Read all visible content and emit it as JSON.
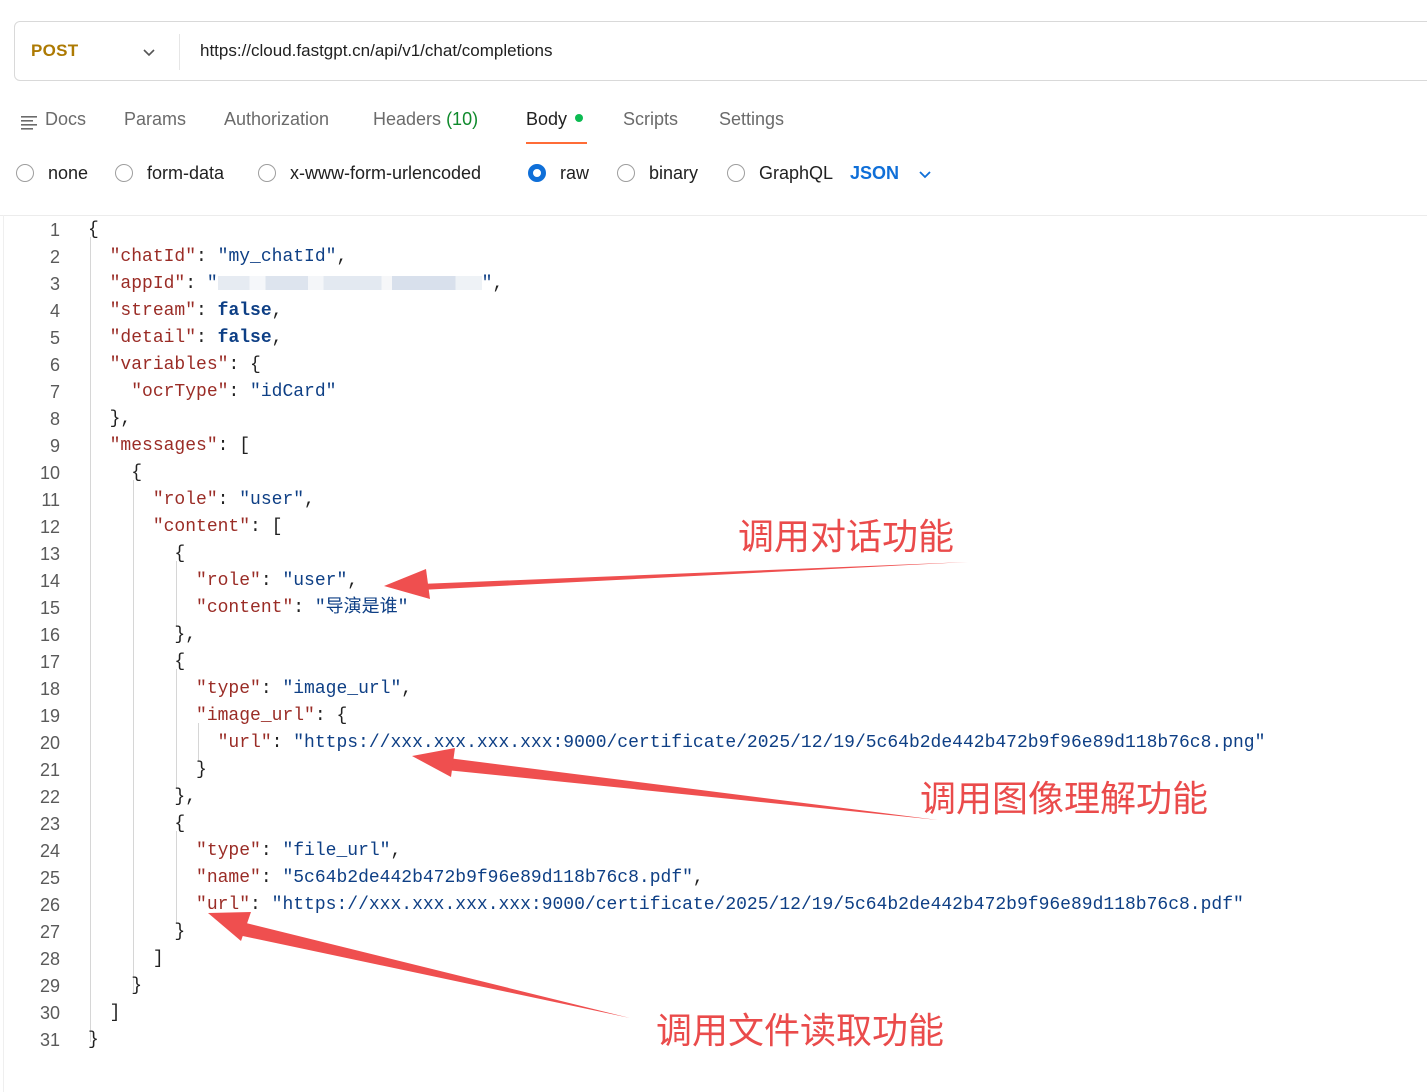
{
  "request": {
    "method": "POST",
    "url": "https://cloud.fastgpt.cn/api/v1/chat/completions"
  },
  "tabs": {
    "docs": "Docs",
    "params": "Params",
    "authorization": "Authorization",
    "headers": "Headers",
    "headers_count": "(10)",
    "body": "Body",
    "scripts": "Scripts",
    "settings": "Settings"
  },
  "body_types": {
    "none": "none",
    "form_data": "form-data",
    "urlencoded": "x-www-form-urlencoded",
    "raw": "raw",
    "binary": "binary",
    "graphql": "GraphQL",
    "selected": "raw",
    "format": "JSON"
  },
  "editor": {
    "line_numbers": [
      "1",
      "2",
      "3",
      "4",
      "5",
      "6",
      "7",
      "8",
      "9",
      "10",
      "11",
      "12",
      "13",
      "14",
      "15",
      "16",
      "17",
      "18",
      "19",
      "20",
      "21",
      "22",
      "23",
      "24",
      "25",
      "26",
      "27",
      "28",
      "29",
      "30",
      "31"
    ],
    "keys": {
      "chatId": "\"chatId\"",
      "appId": "\"appId\"",
      "stream": "\"stream\"",
      "detail": "\"detail\"",
      "variables": "\"variables\"",
      "ocrType": "\"ocrType\"",
      "messages": "\"messages\"",
      "role": "\"role\"",
      "content": "\"content\"",
      "type": "\"type\"",
      "image_url": "\"image_url\"",
      "url": "\"url\"",
      "name": "\"name\""
    },
    "values": {
      "chatId": "\"my_chatId\"",
      "stream": "false",
      "detail": "false",
      "ocrType": "\"idCard\"",
      "role_user": "\"user\"",
      "content_text": "\"导演是谁\"",
      "type_image": "\"image_url\"",
      "image_url": "\"https://xxx.xxx.xxx.xxx:9000/certificate/2025/12/19/5c64b2de442b472b9f96e89d118b76c8.png\"",
      "type_file": "\"file_url\"",
      "file_name": "\"5c64b2de442b472b9f96e89d118b76c8.pdf\"",
      "file_url": "\"https://xxx.xxx.xxx.xxx:9000/certificate/2025/12/19/5c64b2de442b472b9f96e89d118b76c8.pdf\""
    }
  },
  "annotations": {
    "chat": "调用对话功能",
    "image": "调用图像理解功能",
    "file": "调用文件读取功能",
    "color": "#ea4b4b"
  },
  "colors": {
    "method": "#ad7a03",
    "accent": "#ff6c37",
    "link": "#0f6fd8",
    "status_dot": "#0cbb52"
  }
}
